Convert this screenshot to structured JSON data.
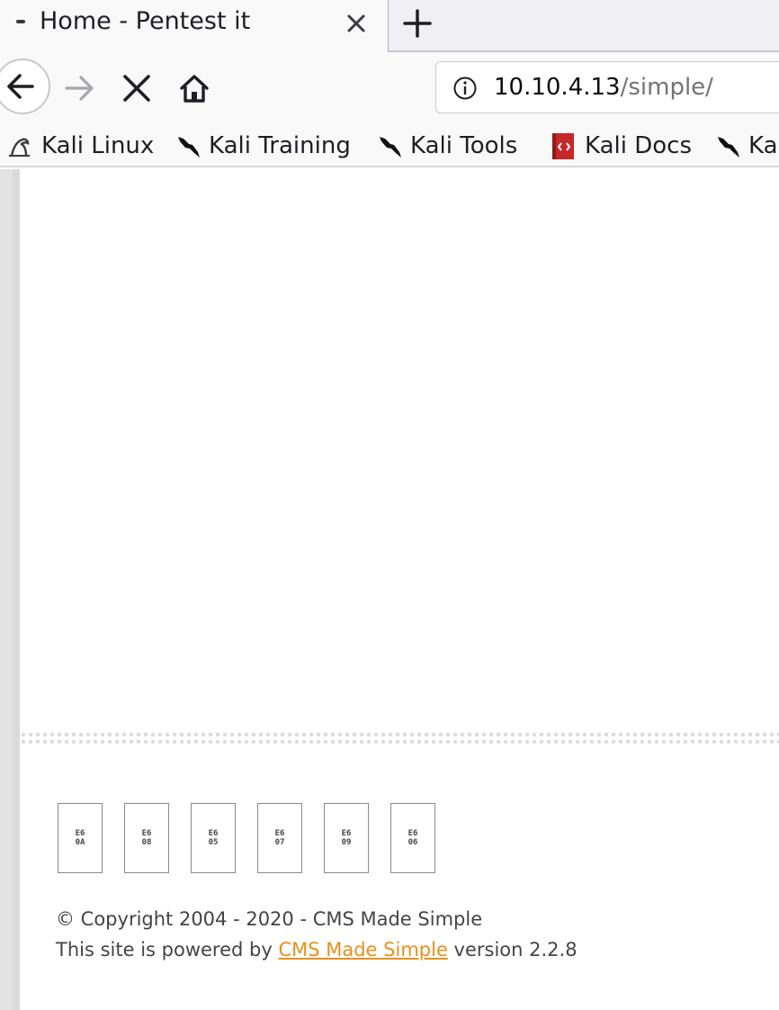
{
  "browser": {
    "tab": {
      "title": "Home - Pentest it",
      "close_icon": "close-icon"
    },
    "new_tab_icon": "plus-icon",
    "nav": {
      "back_icon": "arrow-left-icon",
      "forward_icon": "arrow-right-icon",
      "stop_icon": "stop-x-icon",
      "home_icon": "home-icon"
    },
    "url": {
      "host": "10.10.4.13",
      "path": "/simple/",
      "info_icon": "info-icon"
    },
    "bookmarks": [
      {
        "label": "Kali Linux",
        "icon": "kali-dragon-icon"
      },
      {
        "label": "Kali Training",
        "icon": "kali-dragon-icon"
      },
      {
        "label": "Kali Tools",
        "icon": "kali-dragon-icon"
      },
      {
        "label": "Kali Docs",
        "icon": "kali-docs-icon"
      },
      {
        "label": "Ka",
        "icon": "kali-dragon-icon"
      }
    ]
  },
  "page": {
    "badges": [
      "E6\n0A",
      "E6\n08",
      "E6\n05",
      "E6\n07",
      "E6\n09",
      "E6\n06"
    ],
    "footer": {
      "copyright": "© Copyright 2004 - 2020 - CMS Made Simple",
      "powered_prefix": "This site is powered by ",
      "powered_link": "CMS Made Simple",
      "powered_suffix": " version 2.2.8"
    },
    "colors": {
      "link": "#e8901c",
      "text": "#444444"
    }
  }
}
